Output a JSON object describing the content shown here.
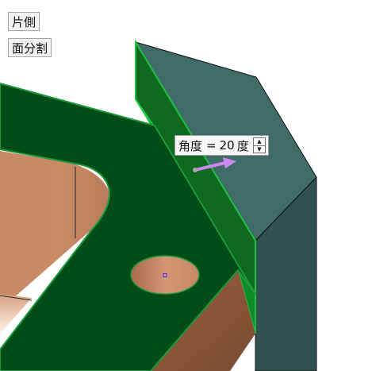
{
  "toolbar": {
    "single_side_label": "片側",
    "face_split_label": "面分割"
  },
  "angle_input": {
    "label": "角度",
    "equals": "=",
    "value": "20",
    "unit": "度"
  },
  "icons": {
    "spinner_up": "▲",
    "spinner_down": "▼"
  },
  "colors": {
    "top_face": "#004d1a",
    "face_edge": "#1fa03a",
    "flange_face": "#3d6b69",
    "copper": "#c08060",
    "direction_arrow": "#cc88ee"
  }
}
